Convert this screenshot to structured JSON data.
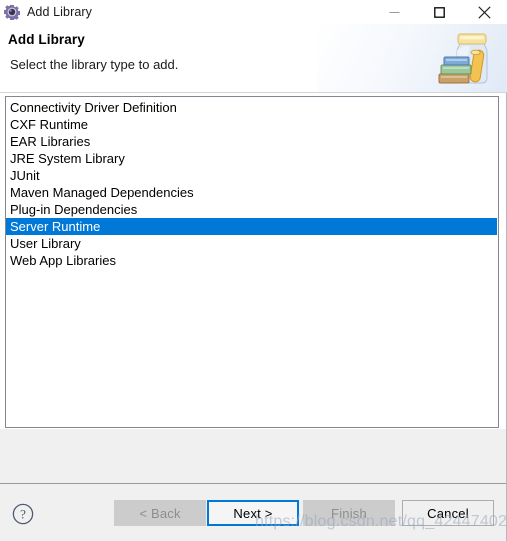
{
  "window": {
    "title": "Add Library",
    "icon": "gear-icon",
    "controls": {
      "minimize": "minimize-icon",
      "maximize": "maximize-icon",
      "close": "close-icon"
    }
  },
  "header": {
    "title": "Add Library",
    "description": "Select the library type to add.",
    "image": "library-jar-books-icon"
  },
  "list": {
    "name": "library-type-list",
    "items": [
      {
        "label": "Connectivity Driver Definition",
        "selected": false
      },
      {
        "label": "CXF Runtime",
        "selected": false
      },
      {
        "label": "EAR Libraries",
        "selected": false
      },
      {
        "label": "JRE System Library",
        "selected": false
      },
      {
        "label": "JUnit",
        "selected": false
      },
      {
        "label": "Maven Managed Dependencies",
        "selected": false
      },
      {
        "label": "Plug-in Dependencies",
        "selected": false
      },
      {
        "label": "Server Runtime",
        "selected": true
      },
      {
        "label": "User Library",
        "selected": false
      },
      {
        "label": "Web App Libraries",
        "selected": false
      }
    ],
    "selected_value": "Server Runtime"
  },
  "buttons": {
    "help": "help-icon",
    "back": "< Back",
    "next": "Next >",
    "finish": "Finish",
    "cancel": "Cancel"
  },
  "watermark": "https://blog.csdn.net/qq_42447402",
  "colors": {
    "selection_blue": "#0078d7",
    "dialog_gray": "#f0f0f0",
    "border_gray": "#828790",
    "disabled_text": "#8d8d8d"
  }
}
